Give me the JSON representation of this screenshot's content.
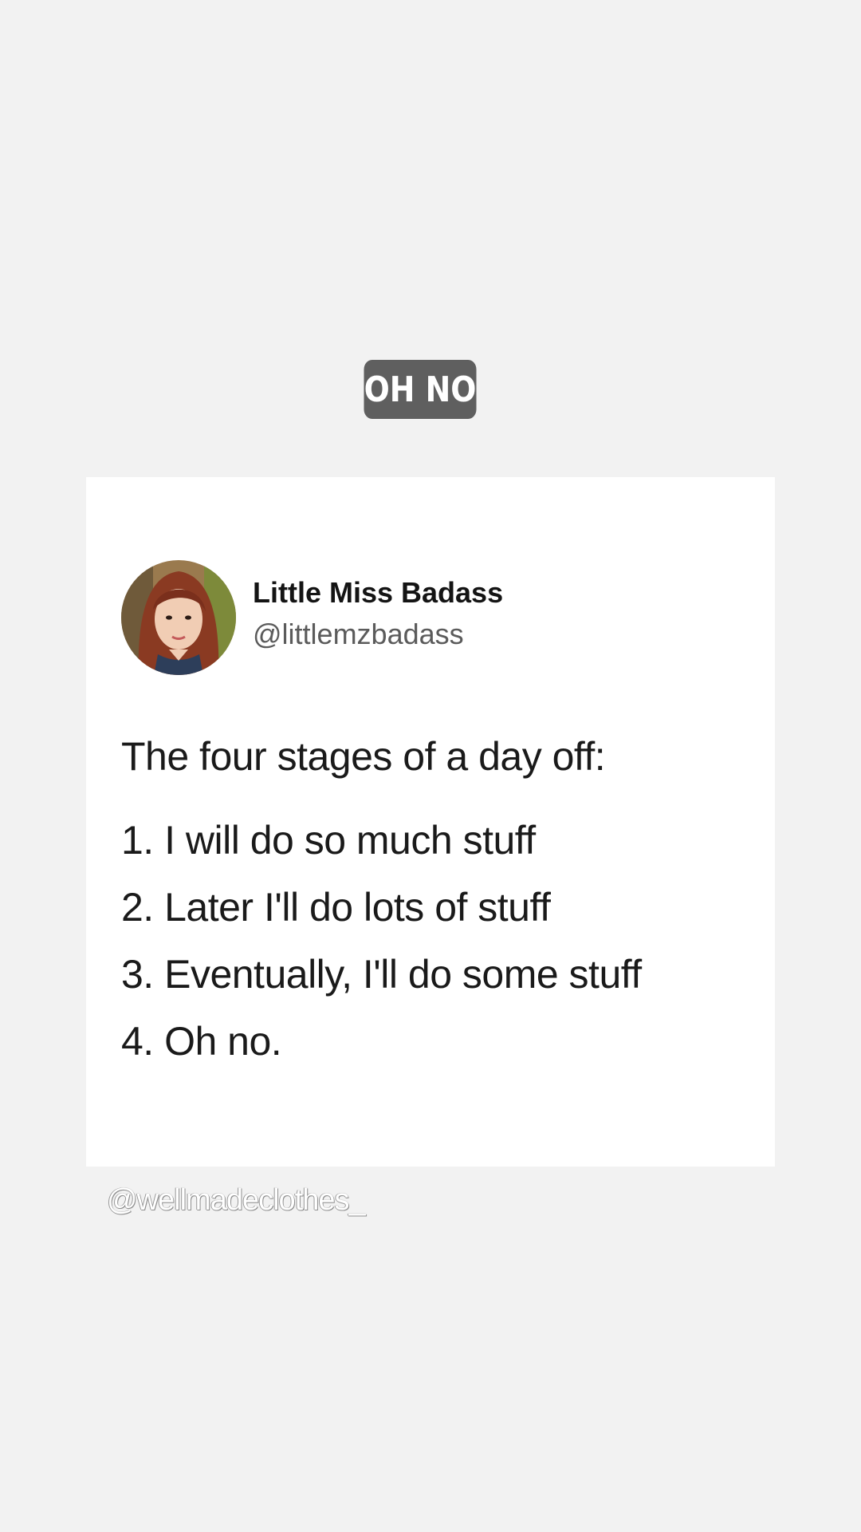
{
  "sticker": {
    "text": "OH NO"
  },
  "tweet": {
    "display_name": "Little Miss Badass",
    "handle": "@littlemzbadass",
    "intro": "The four stages of a day off:",
    "items": [
      "1. I will do so much stuff",
      "2. Later I'll do lots of stuff",
      "3. Eventually, I'll do some stuff",
      "4. Oh no."
    ]
  },
  "watermark": {
    "text": "@wellmadeclothes_"
  },
  "colors": {
    "background": "#f2f2f2",
    "sticker_bg": "#5f5f5f",
    "card_bg": "#ffffff",
    "name_text": "#141414",
    "handle_text": "#5b5b5b",
    "body_text": "#1a1a1a"
  }
}
